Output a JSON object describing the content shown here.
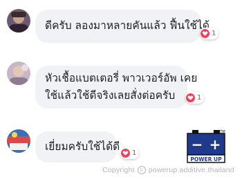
{
  "comments": [
    {
      "text": "ดีครับ ลองมาหลายคันแล้ว ฟื้นใช้ได้",
      "reaction_icon": "heart-icon",
      "reaction_count": "1",
      "avatar_color": "#5a4a6a"
    },
    {
      "text_line1": "หัวเชื้อแบตเตอรี่ พาวเวอร์อัพ เคย",
      "text_line2": "ใช้แล้วใช้ดีจริงเลยสั่งต่อครับ",
      "reaction_icon": "heart-icon",
      "reaction_count": "1",
      "avatar_color": "#b9a7b8"
    },
    {
      "text": "เยี่ยมครับใช้ได้ดี",
      "reaction_icon": "heart-icon",
      "reaction_count": "1",
      "avatar_color": "#3b6fb6"
    }
  ],
  "logo": {
    "icon": "battery-icon",
    "minus": "−",
    "plus": "+",
    "text": "POWER UP",
    "tm": "TM",
    "colors": {
      "battery": "#1f3a8a",
      "terminals": "#111111",
      "brand": "#1f3a8a"
    }
  },
  "watermark": {
    "prefix": "Copyright",
    "symbol": "c",
    "source": "powerup.additive.thailand"
  },
  "colors": {
    "bubble": "#f0f2f5",
    "heart": "#f33e58",
    "text": "#1c1e21"
  }
}
